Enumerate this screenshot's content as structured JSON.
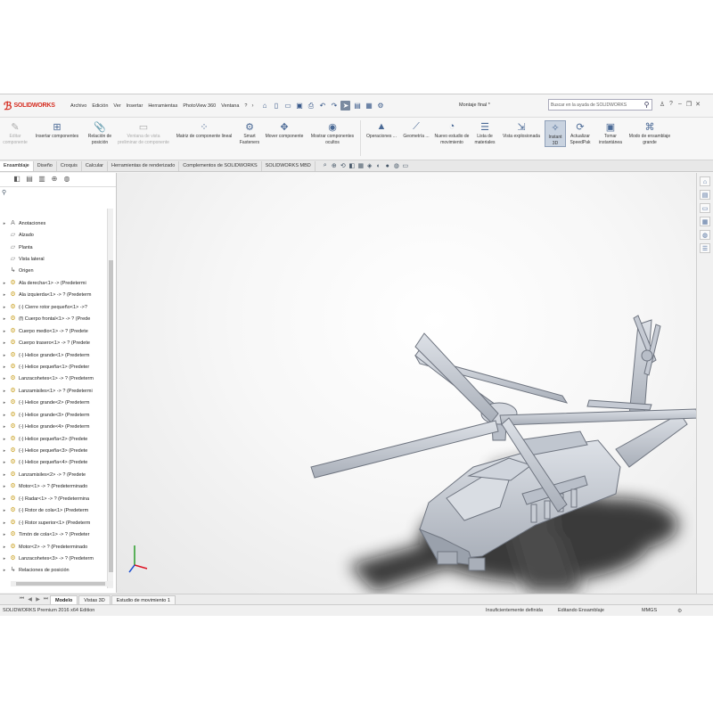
{
  "app": {
    "logo_text": "SOLIDWORKS",
    "menu": [
      "Archivo",
      "Edición",
      "Ver",
      "Insertar",
      "Herramientas",
      "PhotoView 360",
      "Ventana",
      "?"
    ],
    "document_title": "Montaje final *",
    "search_placeholder": "Buscar en la ayuda de SOLIDWORKS"
  },
  "ribbon": [
    {
      "label": "Editar componente",
      "icon": "edit-component-icon",
      "disabled": true
    },
    {
      "label": "Insertar componentes",
      "icon": "insert-components-icon"
    },
    {
      "label": "Relación de posición",
      "icon": "mate-icon"
    },
    {
      "label": "Ventana de vista preliminar de componente",
      "icon": "preview-window-icon",
      "disabled": true
    },
    {
      "label": "Matriz de componente lineal",
      "icon": "linear-pattern-icon"
    },
    {
      "label": "Smart Fasteners",
      "icon": "smart-fasteners-icon"
    },
    {
      "label": "Mover componente",
      "icon": "move-component-icon"
    },
    {
      "label": "Mostrar componentes ocultos",
      "icon": "show-hidden-icon"
    },
    {
      "label": "Operaciones ...",
      "icon": "features-icon"
    },
    {
      "label": "Geometría ...",
      "icon": "reference-geometry-icon"
    },
    {
      "label": "Nuevo estudio de movimiento",
      "icon": "motion-study-icon"
    },
    {
      "label": "Lista de materiales",
      "icon": "bom-icon"
    },
    {
      "label": "Vista explosionada",
      "icon": "exploded-view-icon"
    },
    {
      "label": "Instant 3D",
      "icon": "instant3d-icon",
      "active": true
    },
    {
      "label": "Actualizar SpeedPak",
      "icon": "speedpak-icon"
    },
    {
      "label": "Tomar instantánea",
      "icon": "snapshot-icon"
    },
    {
      "label": "Modo de ensamblaje grande",
      "icon": "large-assembly-icon"
    }
  ],
  "command_tabs": [
    "Ensamblaje",
    "Diseño",
    "Croquis",
    "Calcular",
    "Herramientas de renderizado",
    "Complementos de SOLIDWORKS",
    "SOLIDWORKS MBD"
  ],
  "feature_tree": [
    {
      "label": "Anotaciones",
      "icon": "annotations-icon",
      "type": "note"
    },
    {
      "label": "Alzado",
      "icon": "plane-icon",
      "type": "plane"
    },
    {
      "label": "Planta",
      "icon": "plane-icon",
      "type": "plane"
    },
    {
      "label": "Vista lateral",
      "icon": "plane-icon",
      "type": "plane"
    },
    {
      "label": "Origen",
      "icon": "origin-icon",
      "type": "orig"
    },
    {
      "label": "Ala derecha<1> -> (Predetermi",
      "icon": "component-icon",
      "type": "comp"
    },
    {
      "label": "Ala izquierda<1> -> ? (Predeterm",
      "icon": "component-icon",
      "type": "comp"
    },
    {
      "label": "(-) Cierre rotor pequeño<1> ->?",
      "icon": "component-icon",
      "type": "comp"
    },
    {
      "label": "(f) Cuerpo frontal<1> -> ? (Prede",
      "icon": "component-icon",
      "type": "comp"
    },
    {
      "label": "Cuerpo medio<1> -> ? (Predete",
      "icon": "component-icon",
      "type": "comp"
    },
    {
      "label": "Cuerpo trasero<1> -> ? (Predete",
      "icon": "component-icon",
      "type": "comp"
    },
    {
      "label": "(-) Helice grande<1> (Predeterm",
      "icon": "component-icon",
      "type": "comp"
    },
    {
      "label": "(-) Helice pequeña<1> (Predeter",
      "icon": "component-icon",
      "type": "comp"
    },
    {
      "label": "Lanzacohetes<1> -> ? (Predeterm",
      "icon": "component-icon",
      "type": "comp"
    },
    {
      "label": "Lanzamisiles<1> -> ? (Predetermi",
      "icon": "component-icon",
      "type": "comp"
    },
    {
      "label": "(-) Helice grande<2> (Predeterm",
      "icon": "component-icon",
      "type": "comp"
    },
    {
      "label": "(-) Helice grande<3> (Predeterm",
      "icon": "component-icon",
      "type": "comp"
    },
    {
      "label": "(-) Helice grande<4> (Predeterm",
      "icon": "component-icon",
      "type": "comp"
    },
    {
      "label": "(-) Helice pequeña<2> (Predete",
      "icon": "component-icon",
      "type": "comp"
    },
    {
      "label": "(-) Helice pequeña<3> (Predete",
      "icon": "component-icon",
      "type": "comp"
    },
    {
      "label": "(-) Helice pequeña<4> (Predete",
      "icon": "component-icon",
      "type": "comp"
    },
    {
      "label": "Lanzamisiles<2> -> ? (Predete",
      "icon": "component-icon",
      "type": "comp"
    },
    {
      "label": "Motor<1> -> ? (Predeterminado",
      "icon": "component-icon",
      "type": "comp"
    },
    {
      "label": "(-) Radar<1> -> ? (Predetermina",
      "icon": "component-icon",
      "type": "comp"
    },
    {
      "label": "(-) Rotor de cola<1> (Predeterm",
      "icon": "component-icon",
      "type": "comp"
    },
    {
      "label": "(-) Rotor superior<1> (Predeterm",
      "icon": "component-icon",
      "type": "comp"
    },
    {
      "label": "Timón de cola<1> -> ? (Predeter",
      "icon": "component-icon",
      "type": "comp"
    },
    {
      "label": "Motor<2> -> ? (Predeterminado",
      "icon": "component-icon",
      "type": "comp"
    },
    {
      "label": "Lanzacohetes<3> -> ? (Predeterm",
      "icon": "component-icon",
      "type": "comp"
    },
    {
      "label": "Relaciones de posición",
      "icon": "mates-folder-icon",
      "type": "orig"
    }
  ],
  "bottom_tabs": [
    "Modelo",
    "Vistas 3D",
    "Estudio de movimiento 1"
  ],
  "status": {
    "app": "SOLIDWORKS Premium 2016 x64 Edition",
    "definition": "Insuficientemente definida",
    "mode": "Editando Ensamblaje",
    "units": "MMGS"
  },
  "colors": {
    "brand": "#d52b1e",
    "model": "#c5cad3",
    "accent": "#4b6a96"
  }
}
